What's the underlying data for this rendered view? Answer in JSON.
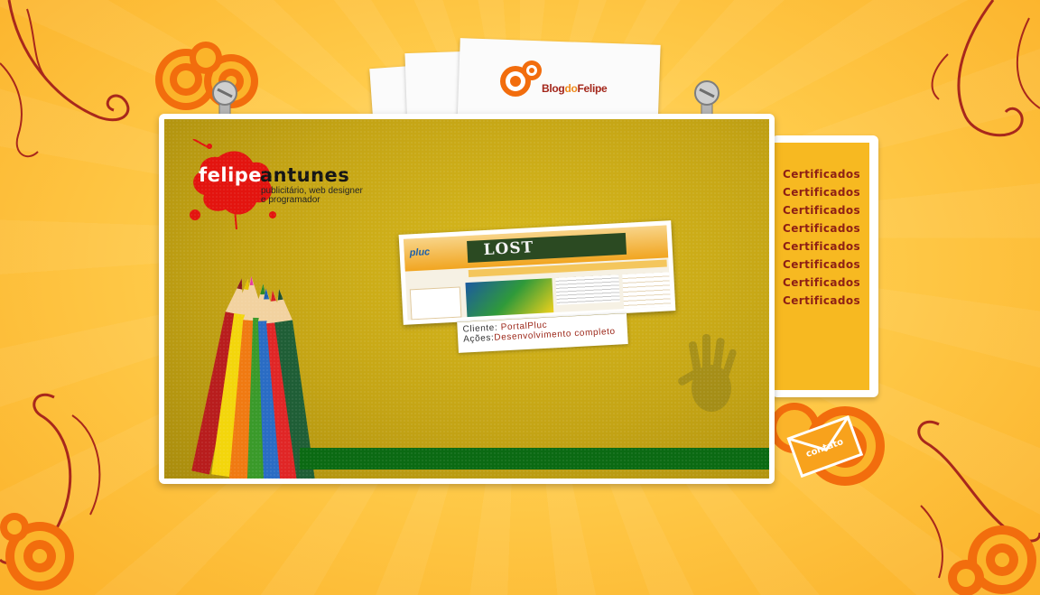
{
  "blog": {
    "label_prefix": "Blog",
    "label_mid": "do",
    "label_suffix": "Felipe"
  },
  "logo": {
    "first_name": "felipe",
    "last_name": "antunes",
    "tagline_1": "publicitário, web designer",
    "tagline_2": "e programador"
  },
  "portfolio": {
    "thumbnail": {
      "site_logo": "pluc",
      "banner_text": "LOST"
    },
    "client_label": "Cliente:",
    "client_value": "PortalPluc",
    "actions_label": "Ações:",
    "actions_value": "Desenvolvimento completo"
  },
  "menu": {
    "items": [
      "Certificados",
      "Certificados",
      "Certificados",
      "Certificados",
      "Certificados",
      "Certificados",
      "Certificados",
      "Certificados"
    ]
  },
  "contact": {
    "label": "contato"
  },
  "colors": {
    "brand_red": "#a3261a",
    "accent_orange": "#f08a1a",
    "stage_yellow": "#c4a415",
    "menu_bg": "#f7b921",
    "green_bar": "#0b6a13"
  }
}
